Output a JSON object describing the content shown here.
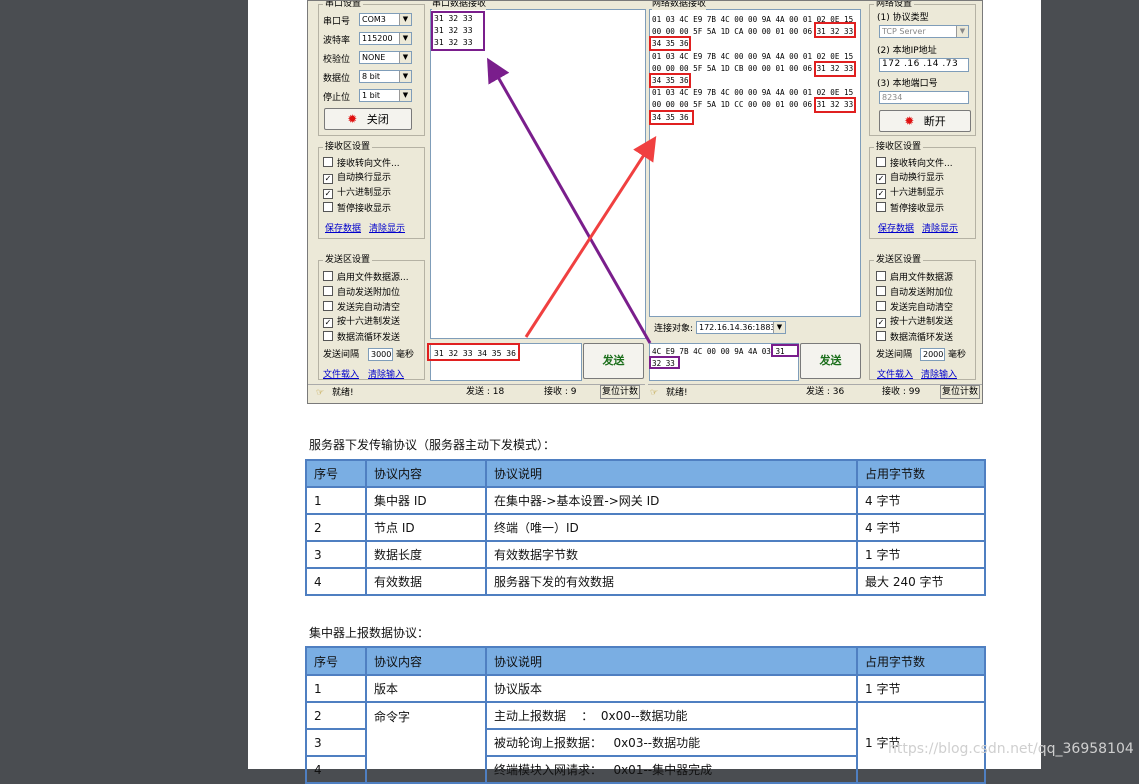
{
  "tool": {
    "serial_group": "串口设置",
    "serial_fields": [
      {
        "label": "串口号",
        "value": "COM3"
      },
      {
        "label": "波特率",
        "value": "115200"
      },
      {
        "label": "校验位",
        "value": "NONE"
      },
      {
        "label": "数据位",
        "value": "8 bit"
      },
      {
        "label": "停止位",
        "value": "1 bit"
      }
    ],
    "close_label": "关闭",
    "recv_group": "接收区设置",
    "recv_options": [
      {
        "label": "接收转向文件...",
        "checked": false
      },
      {
        "label": "自动换行显示",
        "checked": true
      },
      {
        "label": "十六进制显示",
        "checked": true
      },
      {
        "label": "暂停接收显示",
        "checked": false
      }
    ],
    "save_data": "保存数据",
    "clear_display": "清除显示",
    "send_group": "发送区设置",
    "send_options": [
      {
        "label": "启用文件数据源...",
        "checked": false
      },
      {
        "label": "自动发送附加位",
        "checked": false
      },
      {
        "label": "发送完自动清空",
        "checked": false
      },
      {
        "label": "按十六进制发送",
        "checked": true
      },
      {
        "label": "数据流循环发送",
        "checked": false
      }
    ],
    "interval_label": "发送间隔",
    "interval_value": "3000",
    "interval_unit": "毫秒",
    "load_file": "文件载入",
    "clear_input": "清除输入",
    "serial_recv_title": "串口数据接收",
    "serial_recv_lines": [
      "31 32 33",
      "31 32 33",
      "31 32 33"
    ],
    "serial_send_text": "31 32 33 34 35 36",
    "send_label": "发送",
    "status_ready": "就绪!",
    "serial_status": {
      "sent": "发送 : 18",
      "recv": "接收 : 9",
      "reset": "复位计数"
    },
    "net_recv_title": "网络数据接收",
    "net_recv_lines": [
      "01 03 4C E9 7B 4C 00 00 9A 4A 00 01 02 0E 15",
      "00 00 00 5F 5A 1D CA 00 00 01 00 06 31 32 33",
      "34 35 36",
      "01 03 4C E9 7B 4C 00 00 9A 4A 00 01 02 0E 15",
      "00 00 00 5F 5A 1D CB 00 00 01 00 06 31 32 33",
      "34 35 36",
      "01 03 4C E9 7B 4C 00 00 9A 4A 00 01 02 0E 15",
      "00 00 00 5F 5A 1D CC 00 00 01 00 06 31 32 33",
      "34 35 36"
    ],
    "conn_label": "连接对象:",
    "conn_value": "172.16.14.36:1883",
    "net_send_lines": [
      "4C E9 7B 4C 00 00 9A 4A 03 31",
      "32 33"
    ],
    "net_status": {
      "sent": "发送 : 36",
      "recv": "接收 : 99",
      "reset": "复位计数"
    },
    "net_group": "网络设置",
    "protocol_label": "(1) 协议类型",
    "protocol_value": "TCP Server",
    "ip_label": "(2) 本地IP地址",
    "ip_value": "172 .16 .14 .73",
    "port_label": "(3) 本地端口号",
    "port_value": "8234",
    "disconnect_label": "断开",
    "net_recv_group": "接收区设置",
    "net_recv_options": [
      {
        "label": "接收转向文件...",
        "checked": false
      },
      {
        "label": "自动换行显示",
        "checked": true
      },
      {
        "label": "十六进制显示",
        "checked": true
      },
      {
        "label": "暂停接收显示",
        "checked": false
      }
    ],
    "net_send_group": "发送区设置",
    "net_send_options": [
      {
        "label": "启用文件数据源",
        "checked": false
      },
      {
        "label": "自动发送附加位",
        "checked": false
      },
      {
        "label": "发送完自动清空",
        "checked": false
      },
      {
        "label": "按十六进制发送",
        "checked": true
      },
      {
        "label": "数据流循环发送",
        "checked": false
      }
    ],
    "net_interval_value": "2000"
  },
  "section1": {
    "title": "服务器下发传输协议（服务器主动下发模式）：",
    "headers": [
      "序号",
      "协议内容",
      "协议说明",
      "占用字节数"
    ],
    "rows": [
      [
        "1",
        "集中器 ID",
        "在集中器->基本设置->网关 ID",
        "4 字节"
      ],
      [
        "2",
        "节点 ID",
        "终端（唯一）ID",
        "4 字节"
      ],
      [
        "3",
        "数据长度",
        "有效数据字节数",
        "1 字节"
      ],
      [
        "4",
        "有效数据",
        "服务器下发的有效数据",
        "最大 240 字节"
      ]
    ]
  },
  "section2": {
    "title": "集中器上报数据协议：",
    "headers": [
      "序号",
      "协议内容",
      "协议说明",
      "占用字节数"
    ],
    "row1": [
      "1",
      "版本",
      "协议版本",
      "1 字节"
    ],
    "row2_num": "2",
    "row3_num": "3",
    "row4_num": "4",
    "cmd_label": "命令字",
    "cmd_items": [
      "主动上报数据    ：  0x00--数据功能",
      "被动轮询上报数据：   0x03--数据功能",
      "终端模块入网请求：   0x01--集中器完成"
    ],
    "cmd_bytes": "1 字节"
  },
  "watermark": "https://blog.csdn.net/qq_36958104"
}
